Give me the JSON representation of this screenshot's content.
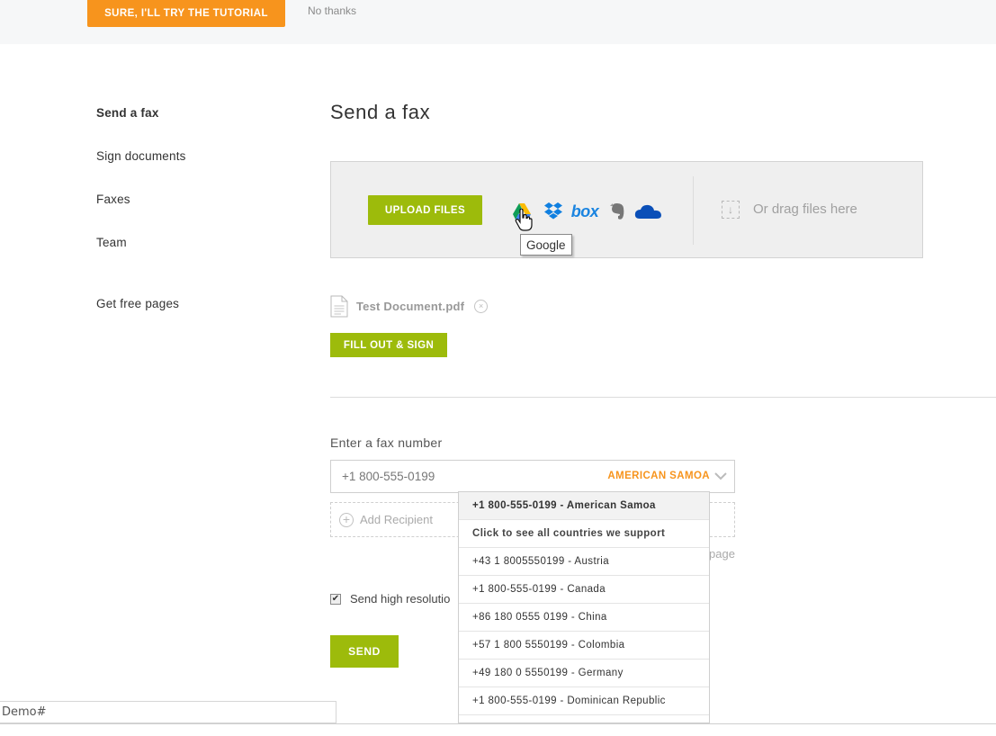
{
  "banner": {
    "tutorial_button": "SURE, I'LL TRY THE TUTORIAL",
    "no_thanks": "No thanks"
  },
  "sidebar": {
    "items": [
      {
        "label": "Send a fax",
        "active": true
      },
      {
        "label": "Sign documents",
        "active": false
      },
      {
        "label": "Faxes",
        "active": false
      },
      {
        "label": "Team",
        "active": false
      },
      {
        "label": "Get free pages",
        "active": false
      }
    ]
  },
  "main": {
    "title": "Send a fax",
    "upload": {
      "button": "UPLOAD FILES",
      "providers": [
        "google-drive-icon",
        "dropbox-icon",
        "box-icon",
        "evernote-icon",
        "onedrive-icon"
      ],
      "box_label": "box",
      "drag_text": "Or drag files here",
      "tooltip": "Google"
    },
    "file": {
      "name": "Test Document.pdf",
      "remove": "×"
    },
    "fill_sign_button": "FILL OUT & SIGN",
    "fax": {
      "label": "Enter a fax number",
      "value": "+1 800-555-0199",
      "country": "AMERICAN SAMOA",
      "add_recipient": "Add Recipient",
      "hidden_fragment": "page"
    },
    "high_resolution": {
      "label": "Send high resolutio",
      "checked": true
    },
    "send_button": "SEND"
  },
  "dropdown": {
    "items": [
      {
        "label": "+1 800-555-0199 - American Samoa",
        "type": "selected"
      },
      {
        "label": "Click to see all countries we support",
        "type": "support"
      },
      {
        "label": "+43 1 8005550199 - Austria",
        "type": "option"
      },
      {
        "label": "+1 800-555-0199 - Canada",
        "type": "option"
      },
      {
        "label": "+86 180 0555 0199 - China",
        "type": "option"
      },
      {
        "label": "+57 1 800 5550199 - Colombia",
        "type": "option"
      },
      {
        "label": "+49 180 0 5550199 - Germany",
        "type": "option"
      },
      {
        "label": "+1 800-555-0199 - Dominican Republic",
        "type": "option"
      }
    ]
  },
  "demo_field": "Demo#",
  "colors": {
    "orange": "#f7941d",
    "green": "#9dbb0b"
  }
}
